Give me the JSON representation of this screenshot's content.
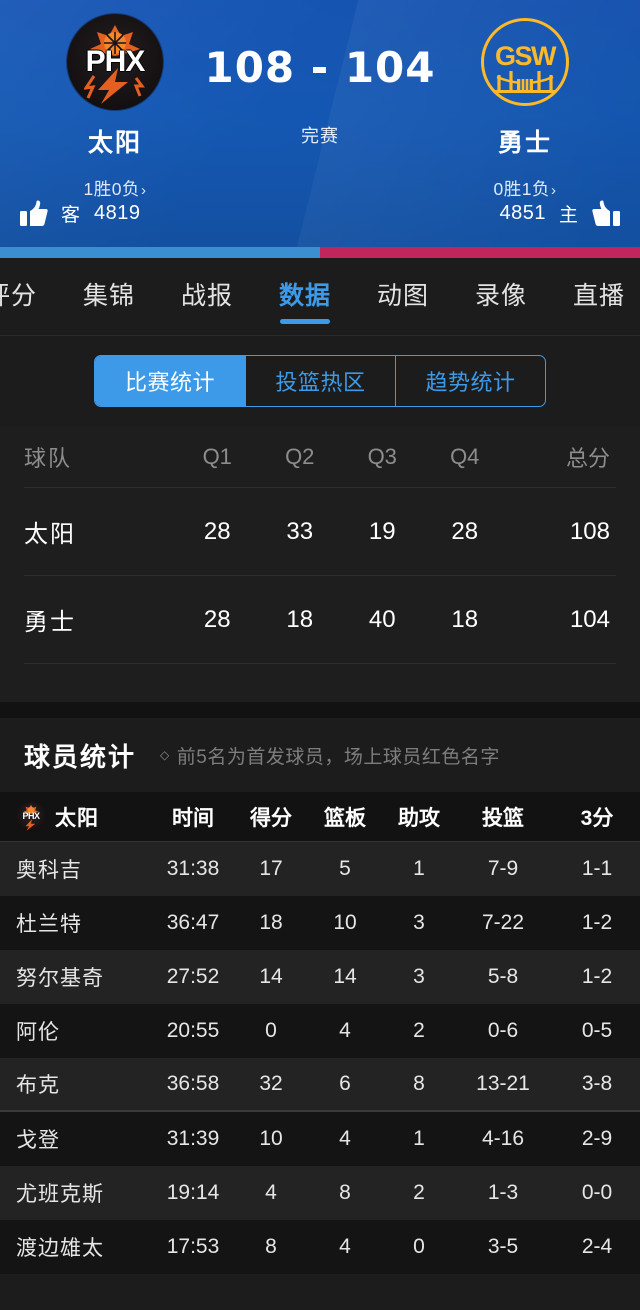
{
  "scoreboard": {
    "away": {
      "abbr": "PHX",
      "name": "太阳",
      "record": "1胜0负",
      "chevron": "›",
      "vote_label": "客",
      "vote_count": "4819",
      "logo_icon": "phoenix-suns-logo-icon"
    },
    "home": {
      "abbr": "GSW",
      "name": "勇士",
      "record": "0胜1负",
      "chevron": "›",
      "vote_label": "主",
      "vote_count": "4851",
      "logo_icon": "golden-state-warriors-logo-icon"
    },
    "score": "108 - 104",
    "status": "完赛",
    "bar_left_color": "#3b8ed0",
    "bar_right_color": "#c0265c",
    "bar_left_pct": 50,
    "thumb_icon": "thumbs-up-icon"
  },
  "tabs": {
    "items": [
      {
        "label": "评分",
        "active": false
      },
      {
        "label": "集锦",
        "active": false
      },
      {
        "label": "战报",
        "active": false
      },
      {
        "label": "数据",
        "active": true
      },
      {
        "label": "动图",
        "active": false
      },
      {
        "label": "录像",
        "active": false
      },
      {
        "label": "直播",
        "active": false
      }
    ],
    "active_color": "#3d9ae8"
  },
  "segment": {
    "items": [
      {
        "label": "比赛统计",
        "active": true
      },
      {
        "label": "投篮热区",
        "active": false
      },
      {
        "label": "趋势统计",
        "active": false
      }
    ],
    "accent_color": "#3d9ae8"
  },
  "quarter_table": {
    "headers": [
      "球队",
      "Q1",
      "Q2",
      "Q3",
      "Q4",
      "总分"
    ],
    "rows": [
      {
        "team": "太阳",
        "q1": "28",
        "q2": "33",
        "q3": "19",
        "q4": "28",
        "total": "108"
      },
      {
        "team": "勇士",
        "q1": "28",
        "q2": "18",
        "q3": "40",
        "q4": "18",
        "total": "104"
      }
    ]
  },
  "player_stats": {
    "title": "球员统计",
    "note": "前5名为首发球员，场上球员红色名字",
    "note_bullet": "◇",
    "team_label": "太阳",
    "team_logo_icon": "phoenix-suns-mini-logo-icon",
    "headers": [
      "时间",
      "得分",
      "篮板",
      "助攻",
      "投篮",
      "3分"
    ],
    "rows": [
      {
        "name": "奥科吉",
        "time": "31:38",
        "pts": "17",
        "reb": "5",
        "ast": "1",
        "fg": "7-9",
        "tp": "1-1"
      },
      {
        "name": "杜兰特",
        "time": "36:47",
        "pts": "18",
        "reb": "10",
        "ast": "3",
        "fg": "7-22",
        "tp": "1-2"
      },
      {
        "name": "努尔基奇",
        "time": "27:52",
        "pts": "14",
        "reb": "14",
        "ast": "3",
        "fg": "5-8",
        "tp": "1-2"
      },
      {
        "name": "阿伦",
        "time": "20:55",
        "pts": "0",
        "reb": "4",
        "ast": "2",
        "fg": "0-6",
        "tp": "0-5"
      },
      {
        "name": "布克",
        "time": "36:58",
        "pts": "32",
        "reb": "6",
        "ast": "8",
        "fg": "13-21",
        "tp": "3-8"
      },
      {
        "name": "戈登",
        "time": "31:39",
        "pts": "10",
        "reb": "4",
        "ast": "1",
        "fg": "4-16",
        "tp": "2-9"
      },
      {
        "name": "尤班克斯",
        "time": "19:14",
        "pts": "4",
        "reb": "8",
        "ast": "2",
        "fg": "1-3",
        "tp": "0-0"
      },
      {
        "name": "渡边雄太",
        "time": "17:53",
        "pts": "8",
        "reb": "4",
        "ast": "0",
        "fg": "3-5",
        "tp": "2-4"
      }
    ],
    "starters_count": 5
  }
}
